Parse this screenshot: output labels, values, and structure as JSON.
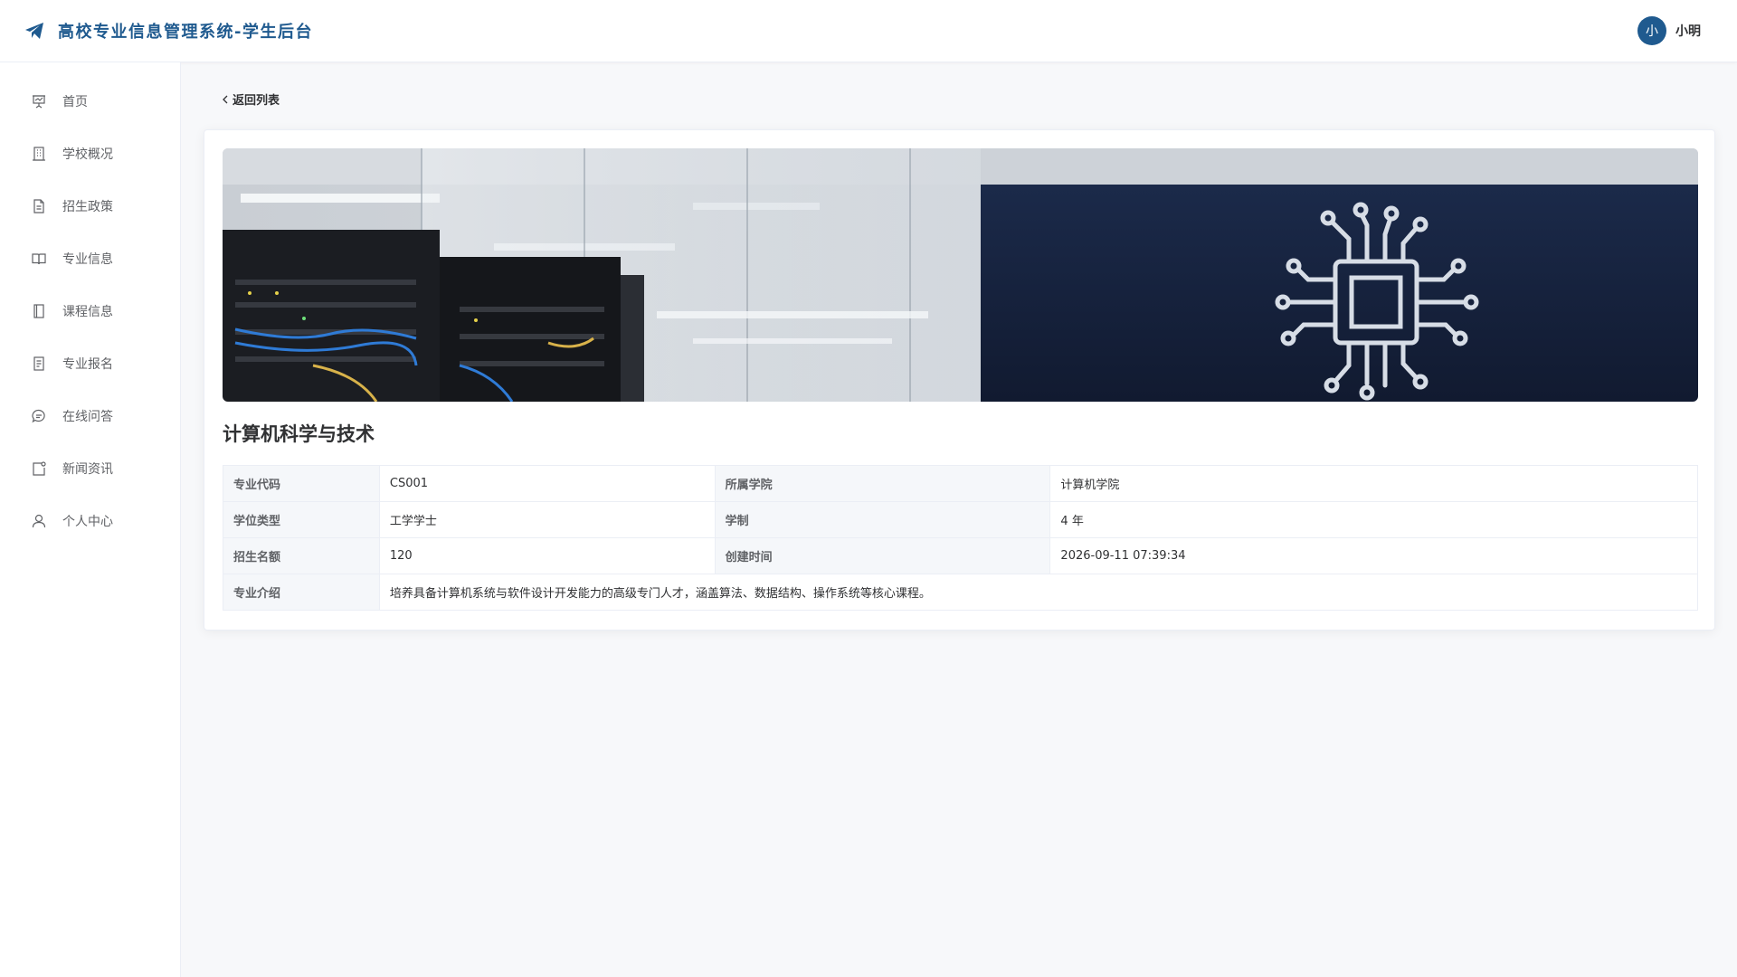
{
  "app": {
    "title": "高校专业信息管理系统-学生后台"
  },
  "user": {
    "avatar_text": "小",
    "name": "小明"
  },
  "sidebar": {
    "items": [
      {
        "label": "首页",
        "icon": "presentation-icon"
      },
      {
        "label": "学校概况",
        "icon": "building-icon"
      },
      {
        "label": "招生政策",
        "icon": "document-icon"
      },
      {
        "label": "专业信息",
        "icon": "book-open-icon"
      },
      {
        "label": "课程信息",
        "icon": "notebook-icon"
      },
      {
        "label": "专业报名",
        "icon": "form-icon"
      },
      {
        "label": "在线问答",
        "icon": "chat-icon"
      },
      {
        "label": "新闻资讯",
        "icon": "news-icon"
      },
      {
        "label": "个人中心",
        "icon": "user-icon"
      }
    ]
  },
  "detail": {
    "back_label": "返回列表",
    "title": "计算机科学与技术",
    "fields": {
      "code_label": "专业代码",
      "code_value": "CS001",
      "college_label": "所属学院",
      "college_value": "计算机学院",
      "degree_label": "学位类型",
      "degree_value": "工学学士",
      "duration_label": "学制",
      "duration_value": "4 年",
      "quota_label": "招生名额",
      "quota_value": "120",
      "created_label": "创建时间",
      "created_value": "2026-09-11 07:39:34",
      "intro_label": "专业介绍",
      "intro_value": "培养具备计算机系统与软件设计开发能力的高级专门人才，涵盖算法、数据结构、操作系统等核心课程。"
    }
  },
  "colors": {
    "brand": "#1f5a8f",
    "banner_dark": "#16233f"
  }
}
